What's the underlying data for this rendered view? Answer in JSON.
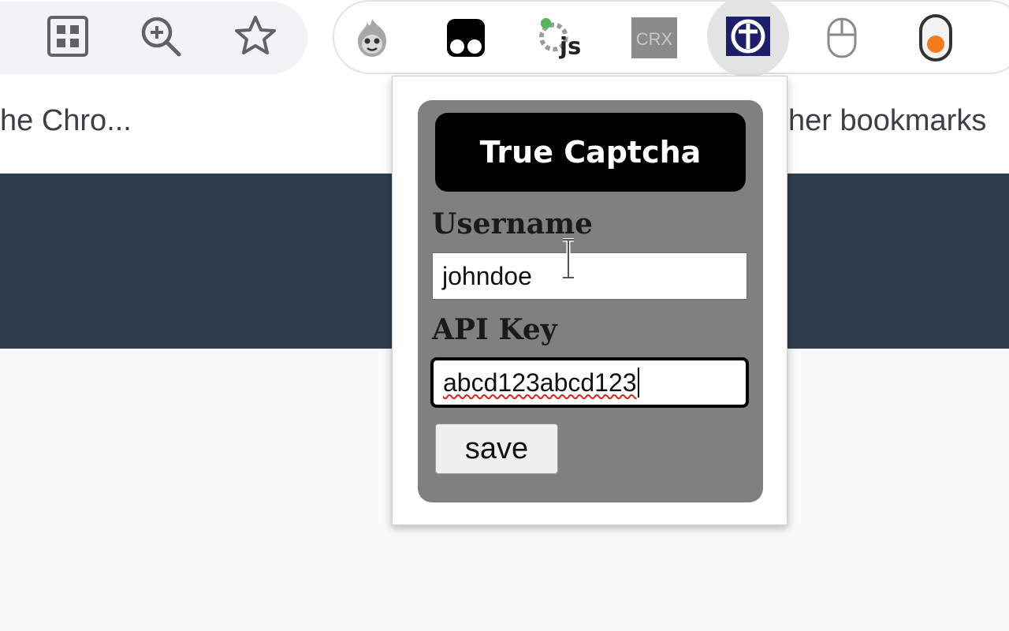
{
  "bookmarks": {
    "left_item": "he Chro...",
    "right_item": "her bookmarks"
  },
  "toolbar": {
    "icons": [
      "apps-grid-icon",
      "zoom-icon",
      "bookmark-star-icon"
    ]
  },
  "extensions": {
    "items": [
      "fire-mascot-extension-icon",
      "tampermonkey-icon",
      "js-gear-icon",
      "crx-icon",
      "true-captcha-icon",
      "mouse-icon",
      "toggle-extension-icon"
    ],
    "crx_label": "CRX",
    "js_label": "js"
  },
  "popup": {
    "title": "True Captcha",
    "username_label": "Username",
    "username_value": "johndoe",
    "apikey_label": "API Key",
    "apikey_value": "abcd123abcd123",
    "save_label": "save"
  },
  "colors": {
    "page_band": "#2f3e4c",
    "panel": "#808080",
    "title_box": "#000000",
    "accent_orange": "#f47a20",
    "captcha_icon_bg": "#1d1f6b"
  }
}
